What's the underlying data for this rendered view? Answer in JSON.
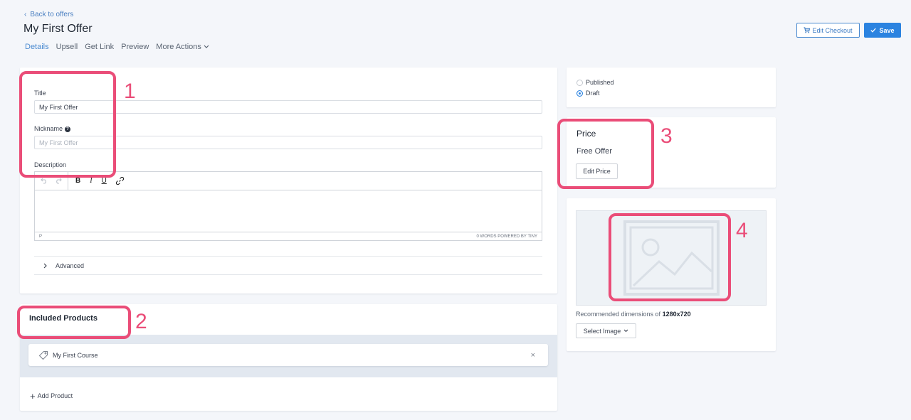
{
  "header": {
    "back_label": "Back to offers",
    "page_title": "My First Offer",
    "tabs": [
      "Details",
      "Upsell",
      "Get Link",
      "Preview",
      "More Actions"
    ],
    "edit_checkout_label": "Edit Checkout",
    "save_label": "Save"
  },
  "details": {
    "title_label": "Title",
    "title_value": "My First Offer",
    "nickname_label": "Nickname",
    "nickname_placeholder": "My First Offer",
    "description_label": "Description",
    "editor_status_left": "P",
    "editor_status_right": "0 WORDS  POWERED BY TINY",
    "advanced_label": "Advanced"
  },
  "products": {
    "heading": "Included Products",
    "items": [
      {
        "name": "My First Course"
      }
    ],
    "add_label": "Add Product"
  },
  "visibility": {
    "options": [
      {
        "label": "Published",
        "selected": false
      },
      {
        "label": "Draft",
        "selected": true
      }
    ]
  },
  "price": {
    "heading": "Price",
    "value": "Free Offer",
    "edit_label": "Edit Price"
  },
  "image": {
    "rec_prefix": "Recommended dimensions of",
    "rec_dims": "1280x720",
    "select_label": "Select Image"
  },
  "annotations": {
    "numbers": [
      "1",
      "2",
      "3",
      "4"
    ],
    "color": "#ea4d78"
  },
  "colors": {
    "accent": "#2b83e0",
    "link": "#4a8ad0"
  }
}
